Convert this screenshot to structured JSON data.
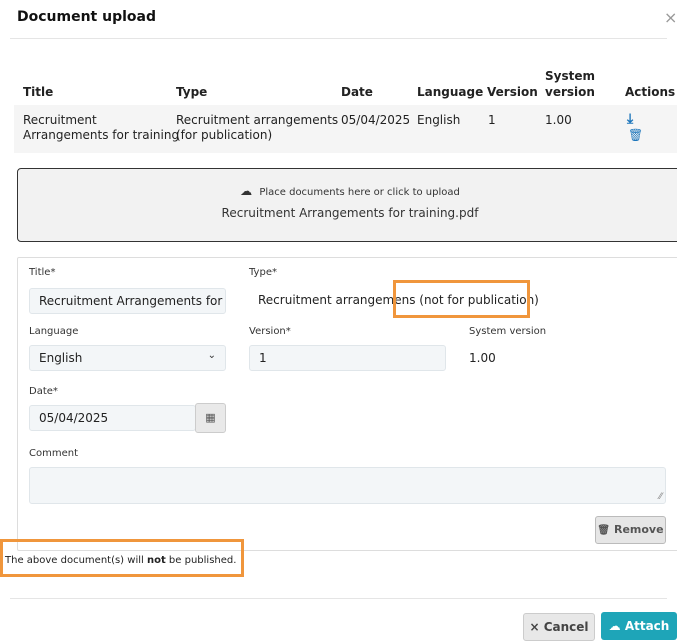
{
  "dialog": {
    "title": "Document upload",
    "close_glyph": "×",
    "icons": {
      "close": "close-icon",
      "download": "download-icon",
      "delete": "trash-icon",
      "upload": "cloud-upload-icon",
      "calendar": "calendar-icon"
    }
  },
  "table": {
    "headers": {
      "title": "Title",
      "type": "Type",
      "date": "Date",
      "language": "Language",
      "version": "Version",
      "system_version_line1": "System",
      "system_version_line2": "version",
      "actions": "Actions"
    },
    "rows": [
      {
        "title_line1": "Recruitment",
        "title_line2": "Arrangements for training",
        "type_line1": "Recruitment arrangements",
        "type_line2": "(for publication)",
        "date": "05/04/2025",
        "language": "English",
        "version": "1",
        "system_version": "1.00",
        "download_glyph": "⤓",
        "delete_glyph": "🗑"
      }
    ]
  },
  "dropzone": {
    "instruction": "Place documents here or click to upload",
    "filename": "Recruitment Arrangements for training.pdf",
    "upload_glyph": "☁"
  },
  "form": {
    "title_label": "Title",
    "title_value": "Recruitment Arrangements for tra",
    "type_label": "Type",
    "type_value_part1": "Recruitment arrangemen",
    "type_value_part2": "s (not for publication)",
    "required_mark": "*",
    "language_label": "Language",
    "language_value": "English",
    "version_label": "Version",
    "version_value": "1",
    "system_version_label": "System version",
    "system_version_value": "1.00",
    "date_label": "Date",
    "date_value": "05/04/2025",
    "calendar_glyph": "▦",
    "comment_label": "Comment",
    "comment_value": "",
    "remove_label": "Remove",
    "remove_glyph": "🗑"
  },
  "notice": {
    "prefix": "The above document(s) will ",
    "emphasis": "not",
    "suffix": " be published."
  },
  "footer": {
    "cancel_label": "Cancel",
    "cancel_glyph": "×",
    "attach_label": "Attach",
    "attach_glyph": "☁"
  },
  "colors": {
    "accent": "#1ea5b8",
    "icon_blue": "#1b75bb",
    "highlight": "#f0963c"
  }
}
